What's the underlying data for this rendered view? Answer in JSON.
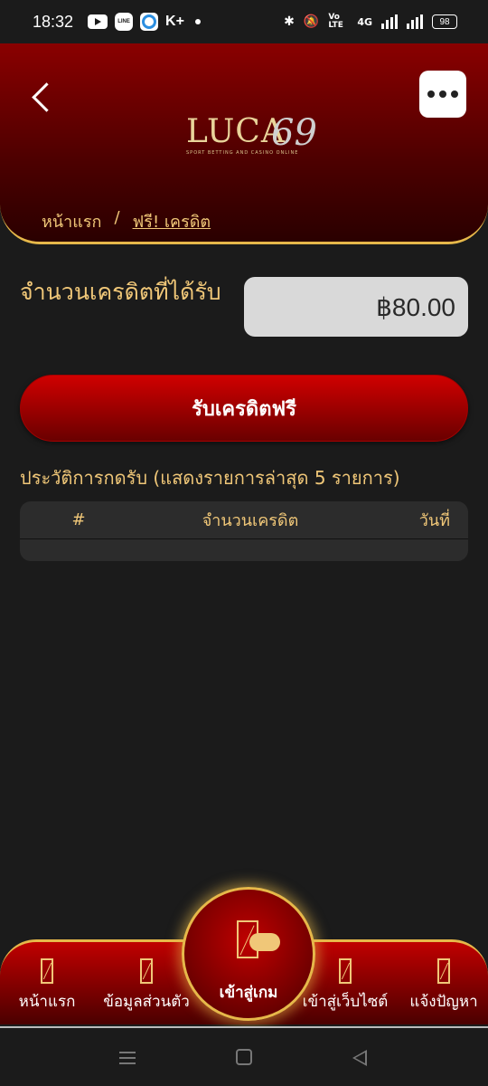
{
  "status_bar": {
    "time": "18:32",
    "kplus": "K+",
    "line_label": "LINE",
    "network": "4G",
    "volte": "Vo LTE",
    "battery": "98"
  },
  "header": {
    "logo_text": "LUCA",
    "logo_number": "69",
    "logo_tagline": "SPORT BETTING AND CASINO ONLINE",
    "breadcrumb_home": "หน้าแรก",
    "breadcrumb_sep": "/",
    "breadcrumb_current": "ฟรี! เครดิต"
  },
  "credit": {
    "label": "จำนวนเครดิตที่ได้รับ",
    "amount": "฿80.00"
  },
  "claim_button": "รับเครดิตฟรี",
  "history": {
    "title": "ประวัติการกดรับ (แสดงรายการล่าสุด 5 รายการ)",
    "columns": [
      "#",
      "จำนวนเครดิต",
      "วันที่"
    ],
    "rows": []
  },
  "bottom_nav": {
    "home": "หน้าแรก",
    "profile": "ข้อมูลส่วนตัว",
    "play": "เข้าสู่เกม",
    "website": "เข้าสู่เว็บไซต์",
    "report": "แจ้งปัญหา"
  },
  "colors": {
    "accent_gold": "#e6b84a",
    "header_red": "#8a0000",
    "background": "#1b1b1b"
  }
}
